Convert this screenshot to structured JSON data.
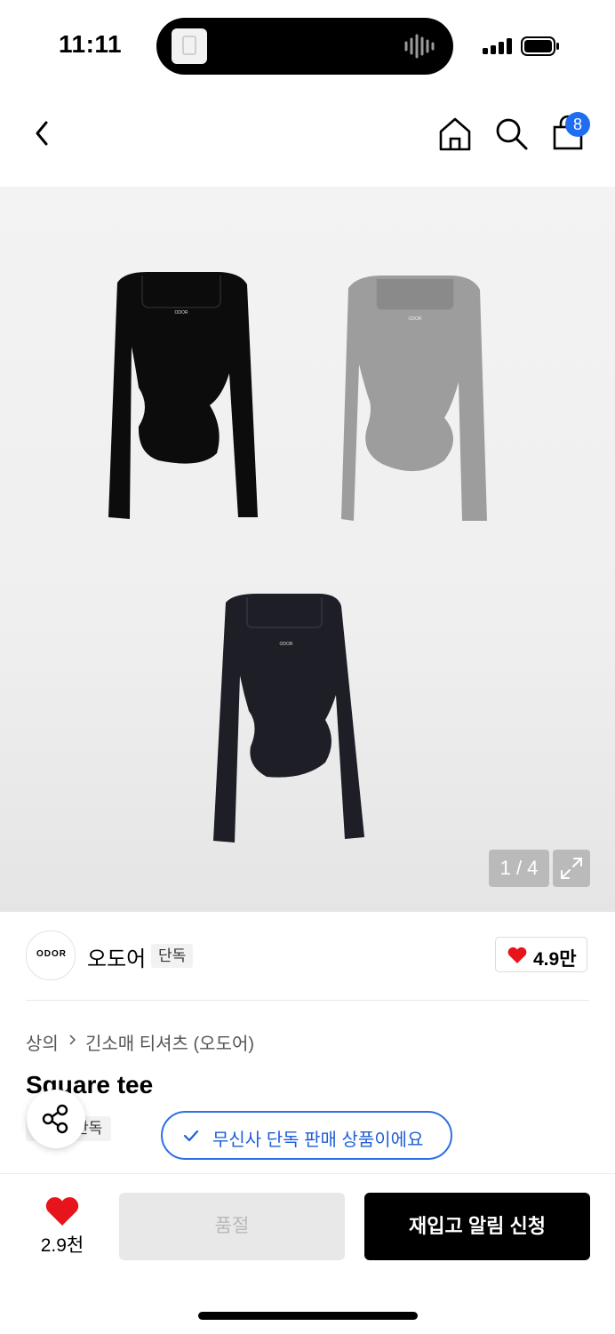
{
  "status_bar": {
    "time": "11:11"
  },
  "header": {
    "cart_count": "8",
    "icons": [
      "chevron-left-icon",
      "home-icon",
      "search-icon",
      "shopping-bag-icon"
    ]
  },
  "gallery": {
    "image_counter": "1 / 4",
    "images": [
      {
        "name": "black long-sleeve square neck tee",
        "logo_text": "ODOR"
      },
      {
        "name": "gray long-sleeve square neck tee",
        "logo_text": "ODOR"
      },
      {
        "name": "navy long-sleeve square neck tee",
        "logo_text": "ODOR"
      }
    ]
  },
  "brand": {
    "logo_text": "ODOR",
    "name": "오도어",
    "badge": "단독",
    "likes": "4.9만"
  },
  "breadcrumb": {
    "category": "상의",
    "subcategory": "긴소매 티셔츠 (오도어)"
  },
  "product": {
    "title": "Square tee",
    "exclusive_badge": "단독"
  },
  "toast": {
    "message": "무신사 단독 판매 상품이에요"
  },
  "bottom_bar": {
    "wishlist_count": "2.9천",
    "soldout_label": "품절",
    "restock_label": "재입고 알림 신청"
  },
  "colors": {
    "accent_blue": "#1f6df0",
    "heart_red": "#e8141c",
    "primary_button": "#000000"
  }
}
